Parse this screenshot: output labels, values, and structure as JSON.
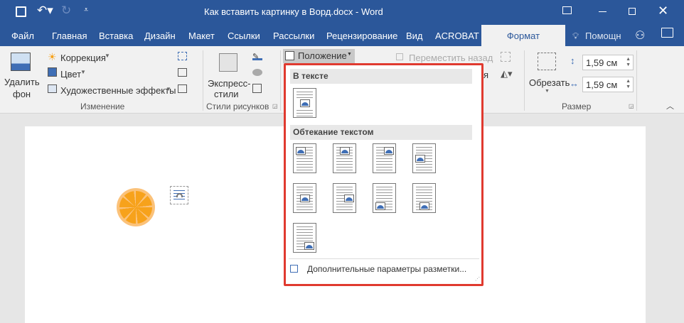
{
  "title": "Как вставить картинку в Ворд.docx - Word",
  "tabs": [
    "Файл",
    "Главная",
    "Вставка",
    "Дизайн",
    "Макет",
    "Ссылки",
    "Рассылки",
    "Рецензирование",
    "Вид",
    "ACROBAT",
    "Формат"
  ],
  "help": "Помощн",
  "ribbon": {
    "remove_bg": [
      "Удалить",
      "фон"
    ],
    "correction": "Коррекция",
    "color": "Цвет",
    "art_effects": "Художественные эффекты",
    "group_change": "Изменение",
    "express_styles": [
      "Экспресс-",
      "стили"
    ],
    "group_styles": "Стили рисунков",
    "position": "Положение",
    "send_back": "Переместить назад",
    "crop": "Обрезать",
    "height": "1,59 см",
    "width": "1,59 см",
    "group_size": "Размер",
    "hidden_partial": "я"
  },
  "menu": {
    "in_text": "В тексте",
    "wrap": "Обтекание текстом",
    "more": "Дополнительные параметры разметки..."
  },
  "colors": {
    "accent": "#2b579a",
    "highlight": "#e03a2f",
    "orange": "#f7a21b"
  }
}
